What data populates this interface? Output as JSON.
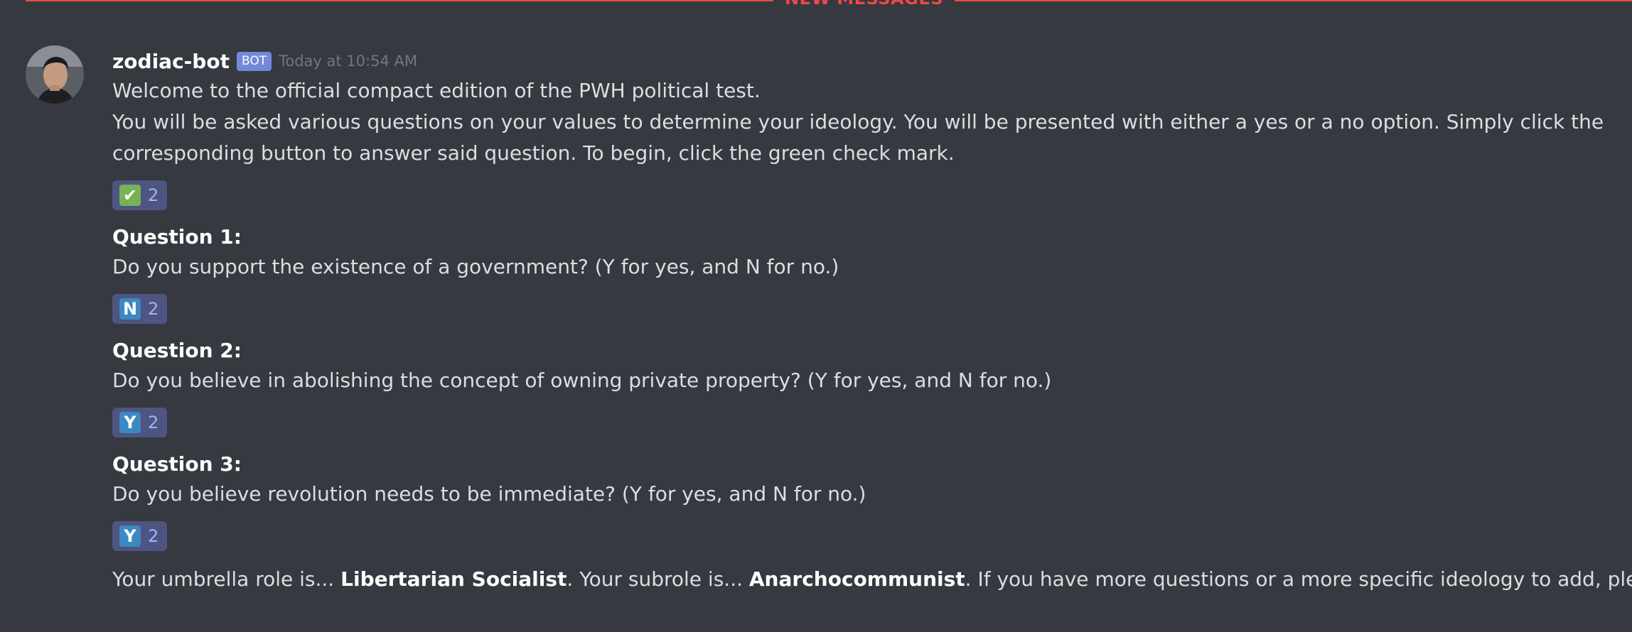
{
  "divider": {
    "label": "NEW MESSAGES"
  },
  "message": {
    "author": "zodiac-bot",
    "badge": "BOT",
    "timestamp": "Today at 10:54 AM",
    "intro_line1": "Welcome to the official compact edition of the PWH political test.",
    "intro_line2": "You will be asked various questions on your values to determine your ideology. You will be presented with either a yes or a no option. Simply click the corresponding button to answer said question. To begin, click the green check mark."
  },
  "reactions": [
    {
      "emoji": "✔",
      "icon": "check-mark-icon",
      "count": "2"
    },
    {
      "emoji": "N",
      "icon": "regional-n-icon",
      "count": "2"
    },
    {
      "emoji": "Y",
      "icon": "regional-y-icon",
      "count": "2"
    },
    {
      "emoji": "Y",
      "icon": "regional-y-icon",
      "count": "2"
    }
  ],
  "questions": [
    {
      "title": "Question 1:",
      "text": "Do you support the existence of a government? (Y for yes, and N for no.)"
    },
    {
      "title": "Question 2:",
      "text": "Do you believe in abolishing the concept of owning private property? (Y for yes, and N for no.)"
    },
    {
      "title": "Question 3:",
      "text": "Do you believe revolution needs to be immediate? (Y for yes, and N for no.)"
    }
  ],
  "result": {
    "prefix": "Your umbrella role is... ",
    "umbrella": "Libertarian Socialist",
    "middle": ". Your subrole is... ",
    "subrole": "Anarchocommunist",
    "suffix": ". If you have more questions or a more specific ideology to add, please DM"
  },
  "colors": {
    "background": "#36393f",
    "divider": "#f04747",
    "bot_badge": "#7289da",
    "reaction_bg": "#4e5580",
    "check_green": "#77b255",
    "letter_blue": "#3b88c3"
  }
}
